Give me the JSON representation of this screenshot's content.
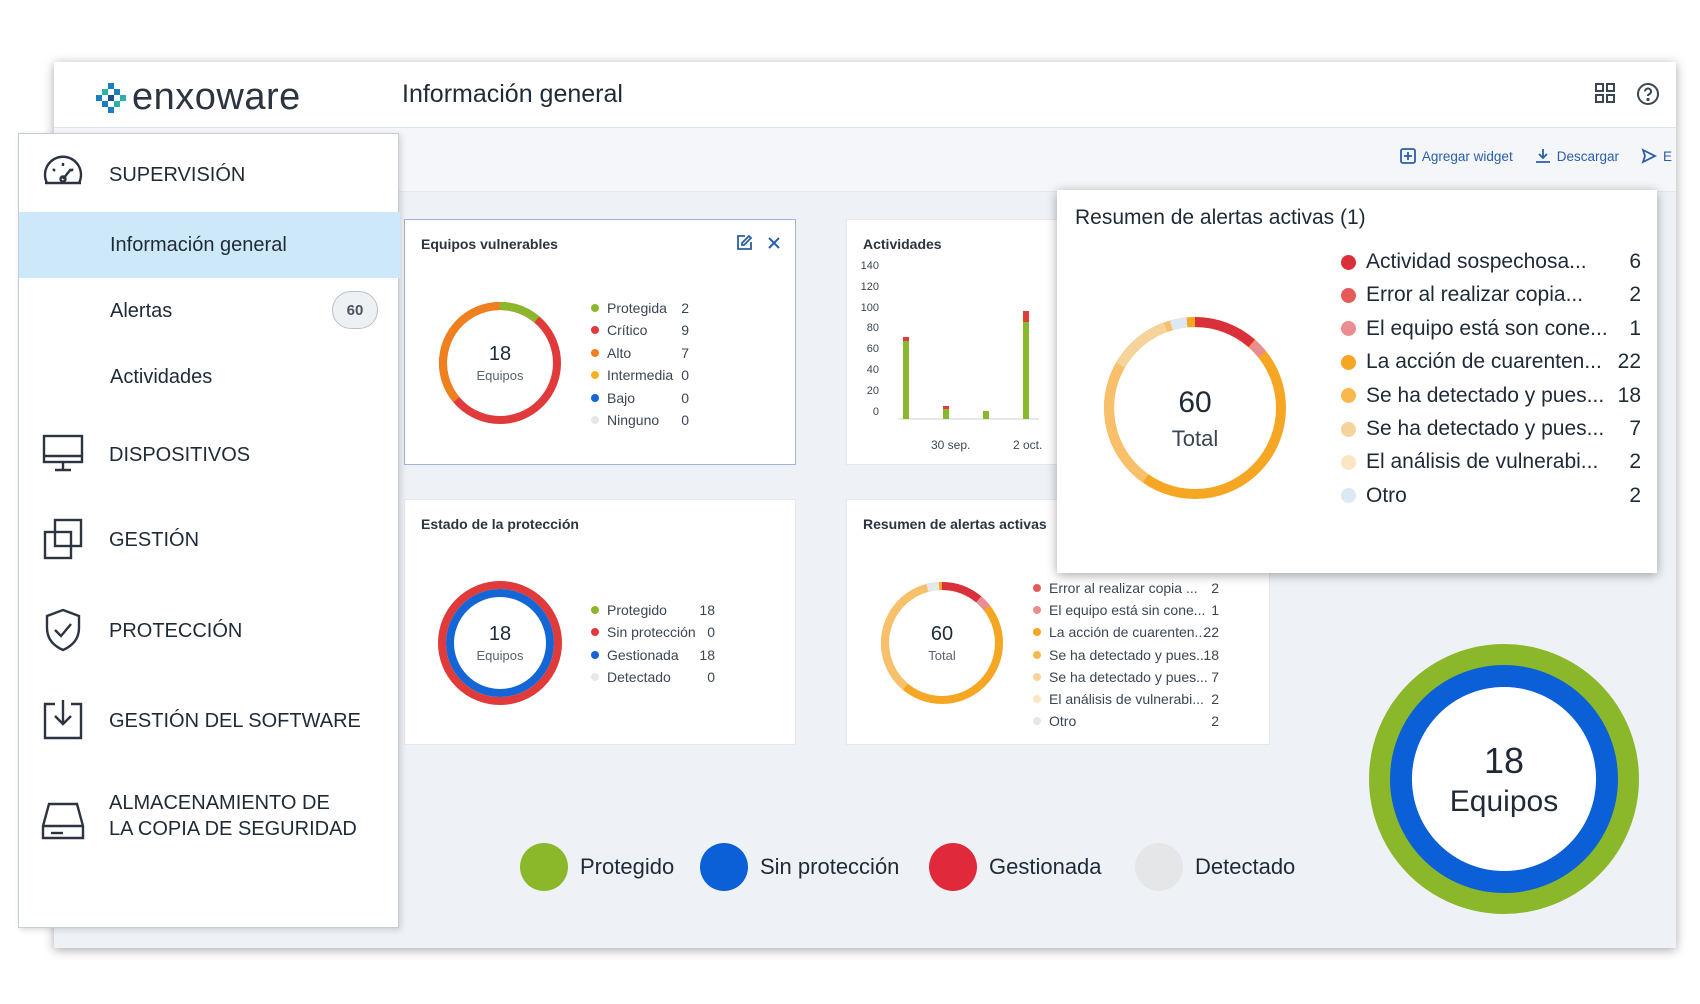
{
  "app": {
    "logo_text": "enxoware",
    "page_title": "Información general"
  },
  "toolbar": {
    "add_widget": "Agregar widget",
    "download": "Descargar",
    "send_partial": "E"
  },
  "sidebar": {
    "sections": [
      {
        "label": "SUPERVISIÓN",
        "icon": "speedometer-icon"
      },
      {
        "label": "DISPOSITIVOS",
        "icon": "monitor-icon"
      },
      {
        "label": "GESTIÓN",
        "icon": "windows-stack-icon"
      },
      {
        "label": "PROTECCIÓN",
        "icon": "shield-check-icon"
      },
      {
        "label": "GESTIÓN DEL SOFTWARE",
        "icon": "software-download-icon"
      },
      {
        "label_line1": "ALMACENAMIENTO DE",
        "label_line2": "LA COPIA DE SEGURIDAD",
        "icon": "hard-drive-icon"
      }
    ],
    "items": [
      {
        "label": "Información general",
        "active": true
      },
      {
        "label": "Alertas",
        "badge": "60"
      },
      {
        "label": "Actividades"
      }
    ]
  },
  "widgets": {
    "vulnerable": {
      "title": "Equipos vulnerables",
      "center_value": "18",
      "center_label": "Equipos",
      "legend": [
        {
          "label": "Protegida",
          "value": "2",
          "color": "#8ab82a"
        },
        {
          "label": "Crítico",
          "value": "9",
          "color": "#e03a3a"
        },
        {
          "label": "Alto",
          "value": "7",
          "color": "#f07f1e"
        },
        {
          "label": "Intermedia",
          "value": "0",
          "color": "#f5b522"
        },
        {
          "label": "Bajo",
          "value": "0",
          "color": "#1466d6"
        },
        {
          "label": "Ninguno",
          "value": "0",
          "color": "#e4e7eb"
        }
      ]
    },
    "activities": {
      "title": "Actividades",
      "y_ticks": [
        "140",
        "120",
        "100",
        "80",
        "60",
        "40",
        "20",
        "0"
      ],
      "x_labels": [
        "30 sep.",
        "2 oct."
      ]
    },
    "protection": {
      "title": "Estado de la protección",
      "center_value": "18",
      "center_label": "Equipos",
      "legend": [
        {
          "label": "Protegido",
          "value": "18",
          "color": "#8ab82a"
        },
        {
          "label": "Sin protección",
          "value": "0",
          "color": "#e03a3a"
        },
        {
          "label": "Gestionada",
          "value": "18",
          "color": "#1466d6"
        },
        {
          "label": "Detectado",
          "value": "0",
          "color": "#e4e7eb"
        }
      ]
    },
    "alerts_summary": {
      "title": "Resumen de alertas activas",
      "center_value": "60",
      "center_label": "Total",
      "legend": [
        {
          "label": "Actividad sospechosa ...",
          "value": "6",
          "color": "#d9303c"
        },
        {
          "label": "Error al realizar copia ...",
          "value": "2",
          "color": "#e65a5a"
        },
        {
          "label": "El equipo está sin cone...",
          "value": "1",
          "color": "#ea8d92"
        },
        {
          "label": "La acción de cuarenten...",
          "value": "22",
          "color": "#f5a623"
        },
        {
          "label": "Se ha detectado y pues...",
          "value": "18",
          "color": "#f8b84e"
        },
        {
          "label": "Se ha detectado y pues...",
          "value": "7",
          "color": "#f6d39a"
        },
        {
          "label": "El análisis de vulnerabi...",
          "value": "2",
          "color": "#fbe6c4"
        },
        {
          "label": "Otro",
          "value": "2",
          "color": "#e4e7eb"
        }
      ]
    }
  },
  "popup": {
    "title": "Resumen de alertas activas (1)",
    "center_value": "60",
    "center_label": "Total",
    "legend": [
      {
        "label": "Actividad sospechosa...",
        "value": "6",
        "color": "#d9303c"
      },
      {
        "label": "Error al realizar copia...",
        "value": "2",
        "color": "#e65a5a"
      },
      {
        "label": "El equipo está son cone...",
        "value": "1",
        "color": "#ea8d92"
      },
      {
        "label": "La acción de cuarenten...",
        "value": "22",
        "color": "#f5a623"
      },
      {
        "label": "Se ha detectado y pues...",
        "value": "18",
        "color": "#f8b84e"
      },
      {
        "label": "Se ha detectado y pues...",
        "value": "7",
        "color": "#f6d39a"
      },
      {
        "label": "El análisis de vulnerabi...",
        "value": "2",
        "color": "#fbe6c4"
      },
      {
        "label": "Otro",
        "value": "2",
        "color": "#dce8f4"
      }
    ]
  },
  "big_donut": {
    "value": "18",
    "label": "Equipos"
  },
  "big_legend": [
    {
      "label": "Protegido",
      "color": "#8ab82a"
    },
    {
      "label": "Sin protección",
      "color": "#0b5fd7"
    },
    {
      "label": "Gestionada",
      "color": "#e0293a"
    },
    {
      "label": "Detectado",
      "color": "#e4e6e8"
    }
  ]
}
